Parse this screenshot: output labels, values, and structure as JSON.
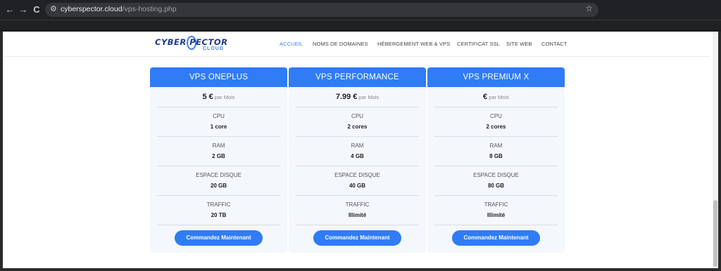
{
  "browser": {
    "back_icon": "←",
    "forward_icon": "→",
    "reload_icon": "C",
    "url_host": "cyberspector.cloud",
    "url_path": "/vps-hosting.php",
    "star_icon": "☆",
    "tune_icon": "⚙"
  },
  "logo": {
    "line1": "CYBER  PECTOR",
    "line2": "CLOUD"
  },
  "nav": {
    "items": [
      {
        "label": "ACCUEIL"
      },
      {
        "label": "NOMS DE DOMAINES"
      },
      {
        "label": "HÉBERGEMENT WEB & VPS"
      },
      {
        "label": "CERTIFICAT SSL"
      },
      {
        "label": "SITE WEB"
      },
      {
        "label": "CONTACT"
      }
    ],
    "accent": "#3b82f6"
  },
  "plans": [
    {
      "title": "VPS ONEPLUS",
      "price": "5 €",
      "per": "par Mois",
      "specs": [
        {
          "label": "CPU",
          "value": "1 core"
        },
        {
          "label": "RAM",
          "value": "2 GB"
        },
        {
          "label": "ESPACE DISQUE",
          "value": "20 GB"
        },
        {
          "label": "TRAFFIC",
          "value": "20 TB"
        }
      ],
      "button": "Commandez Maintenant"
    },
    {
      "title": "VPS PERFORMANCE",
      "price": "7.99 €",
      "per": "par Mois",
      "specs": [
        {
          "label": "CPU",
          "value": "2 cores"
        },
        {
          "label": "RAM",
          "value": "4 GB"
        },
        {
          "label": "ESPACE DISQUE",
          "value": "40 GB"
        },
        {
          "label": "TRAFFIC",
          "value": "Illimité"
        }
      ],
      "button": "Commandez Maintenant"
    },
    {
      "title": "VPS PREMIUM X",
      "price": "€",
      "per": "par Mois",
      "specs": [
        {
          "label": "CPU",
          "value": "2 cores"
        },
        {
          "label": "RAM",
          "value": "8 GB"
        },
        {
          "label": "ESPACE DISQUE",
          "value": "80 GB"
        },
        {
          "label": "TRAFFIC",
          "value": "Illimité"
        }
      ],
      "button": "Commandez Maintenant"
    }
  ],
  "colors": {
    "card_header": "#2f7cf6",
    "card_bg": "#f4f7fb",
    "button": "#2f7cf6"
  }
}
